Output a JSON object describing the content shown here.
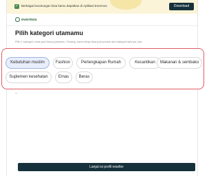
{
  "banner": {
    "text": "Berbagai keuntungan bisa kamu dapatkan di Aplikasi Evermos",
    "download_label": "Download"
  },
  "brand": {
    "name": "evermos"
  },
  "page": {
    "title": "Pilih kategori utamamu",
    "subtitle": "Pilih 1 kategori untuk jadi fokus jualanmu. Tenang, kamu tetap bisa jual produk dari kategori lainnya, kok."
  },
  "categories": [
    {
      "label": "Kebutuhan muslim",
      "selected": true
    },
    {
      "label": "Fashion",
      "selected": false
    },
    {
      "label": "Perlengkapan Rumah",
      "selected": false
    },
    {
      "label": "Kecantikan",
      "selected": false
    },
    {
      "label": "Makanan & sembako",
      "selected": false
    },
    {
      "label": "Suplemen kesehatan",
      "selected": false
    },
    {
      "label": "Emas",
      "selected": false
    },
    {
      "label": "Beras",
      "selected": false
    }
  ],
  "cta": {
    "label": "Lanjut isi profil reseller"
  },
  "colors": {
    "primary_dark": "#16313b",
    "brand_green": "#2f6b3f",
    "highlight_border": "#e05b63",
    "selected_chip_bg": "#e8eefb"
  }
}
